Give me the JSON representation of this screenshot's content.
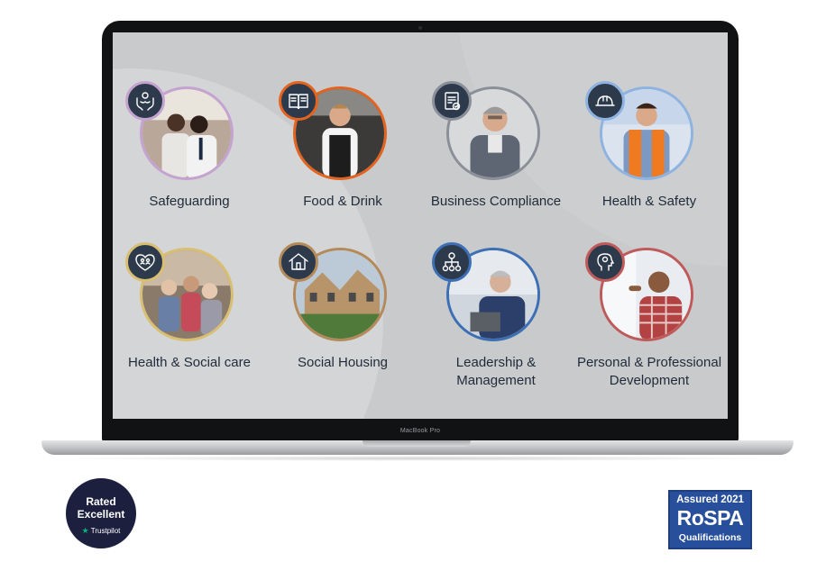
{
  "laptop": {
    "model_label": "MacBook Pro"
  },
  "categories": [
    {
      "label": "Safeguarding",
      "icon": "hands-care-icon",
      "ring_color": "#c5a3d1"
    },
    {
      "label": "Food & Drink",
      "icon": "recipe-book-icon",
      "ring_color": "#e3631f"
    },
    {
      "label": "Business Compliance",
      "icon": "clipboard-check-icon",
      "ring_color": "#8b8f99"
    },
    {
      "label": "Health & Safety",
      "icon": "hard-hat-icon",
      "ring_color": "#8fb3e0"
    },
    {
      "label": "Health & Social care",
      "icon": "heart-people-icon",
      "ring_color": "#d9bf72"
    },
    {
      "label": "Social Housing",
      "icon": "house-icon",
      "ring_color": "#b58a5a"
    },
    {
      "label": "Leadership &",
      "label2": "Management",
      "icon": "network-person-icon",
      "ring_color": "#3c6fb4"
    },
    {
      "label": "Personal & Professional",
      "label2": "Development",
      "icon": "head-gear-icon",
      "ring_color": "#c05a5a"
    }
  ],
  "trustpilot": {
    "line1": "Rated",
    "line2": "Excellent",
    "line3": "Trustpilot",
    "star": "★"
  },
  "rospa": {
    "line1": "Assured 2021",
    "line2": "RoSPA",
    "line3": "Qualifications"
  },
  "colors": {
    "badge_bg": "#2d3a4c",
    "label_text": "#1f2b3a",
    "screen_bg": "#c9cacb"
  }
}
